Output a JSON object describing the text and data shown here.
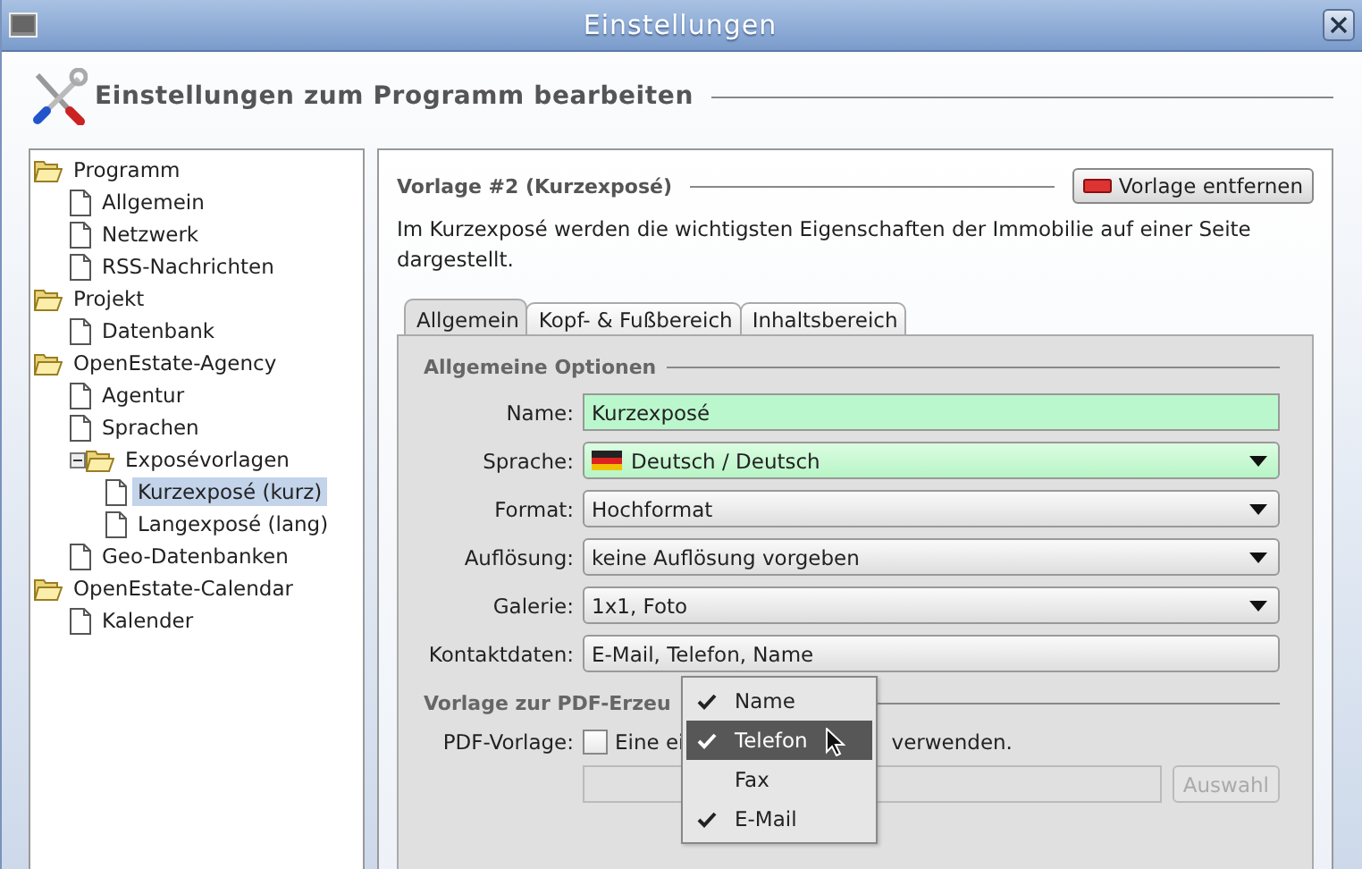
{
  "window": {
    "title": "Einstellungen"
  },
  "header": {
    "title": "Einstellungen zum Programm bearbeiten"
  },
  "tree": [
    {
      "label": "Programm",
      "kind": "folder",
      "expanded": true,
      "selected": false,
      "children": [
        {
          "label": "Allgemein",
          "kind": "page",
          "selected": false
        },
        {
          "label": "Netzwerk",
          "kind": "page",
          "selected": false
        },
        {
          "label": "RSS-Nachrichten",
          "kind": "page",
          "selected": false
        }
      ]
    },
    {
      "label": "Projekt",
      "kind": "folder",
      "expanded": true,
      "selected": false,
      "children": [
        {
          "label": "Datenbank",
          "kind": "page",
          "selected": false
        }
      ]
    },
    {
      "label": "OpenEstate-Agency",
      "kind": "folder",
      "expanded": true,
      "selected": false,
      "children": [
        {
          "label": "Agentur",
          "kind": "page",
          "selected": false
        },
        {
          "label": "Sprachen",
          "kind": "page",
          "selected": false
        },
        {
          "label": "Exposévorlagen",
          "kind": "folder",
          "expanded": true,
          "selected": false,
          "children": [
            {
              "label": "Kurzexposé (kurz)",
              "kind": "page",
              "selected": true
            },
            {
              "label": "Langexposé (lang)",
              "kind": "page",
              "selected": false
            }
          ]
        },
        {
          "label": "Geo-Datenbanken",
          "kind": "page",
          "selected": false
        }
      ]
    },
    {
      "label": "OpenEstate-Calendar",
      "kind": "folder",
      "expanded": true,
      "selected": false,
      "children": [
        {
          "label": "Kalender",
          "kind": "page",
          "selected": false
        }
      ]
    }
  ],
  "template": {
    "title": "Vorlage #2 (Kurzexposé)",
    "remove_button": "Vorlage entfernen",
    "description": "Im Kurzexposé werden die wichtigsten Eigenschaften der Immobilie auf einer Seite dargestellt."
  },
  "tabs": [
    {
      "label": "Allgemein",
      "selected": true
    },
    {
      "label": "Kopf- & Fußbereich",
      "selected": false
    },
    {
      "label": "Inhaltsbereich",
      "selected": false
    }
  ],
  "general_section": {
    "title": "Allgemeine Optionen",
    "fields": [
      {
        "label": "Name:",
        "kind": "text",
        "value": "Kurzexposé",
        "highlighted": true
      },
      {
        "label": "Sprache:",
        "kind": "flag-select",
        "value": "Deutsch / Deutsch",
        "highlighted": true
      },
      {
        "label": "Format:",
        "kind": "select",
        "value": "Hochformat",
        "highlighted": false
      },
      {
        "label": "Auflösung:",
        "kind": "select",
        "value": "keine Auflösung vorgeben",
        "highlighted": false
      },
      {
        "label": "Galerie:",
        "kind": "select",
        "value": "1x1, Foto",
        "highlighted": false
      },
      {
        "label": "Kontaktdaten:",
        "kind": "multi-select",
        "value": "E-Mail, Telefon, Name",
        "highlighted": false
      }
    ]
  },
  "pdf_section": {
    "title": "Vorlage zur PDF-Erzeu",
    "label": "PDF-Vorlage:",
    "checkbox": {
      "checked": false,
      "label_start": "Eine ei",
      "label_end": "verwenden."
    },
    "path_field": {
      "disabled": true
    },
    "browse_button": {
      "label": "Auswahl",
      "disabled": true
    }
  },
  "popup": {
    "items": [
      {
        "label": "Name",
        "checked": true,
        "selected": false
      },
      {
        "label": "Telefon",
        "checked": true,
        "selected": true
      },
      {
        "label": "Fax",
        "checked": false,
        "selected": false
      },
      {
        "label": "E-Mail",
        "checked": true,
        "selected": false
      }
    ]
  }
}
